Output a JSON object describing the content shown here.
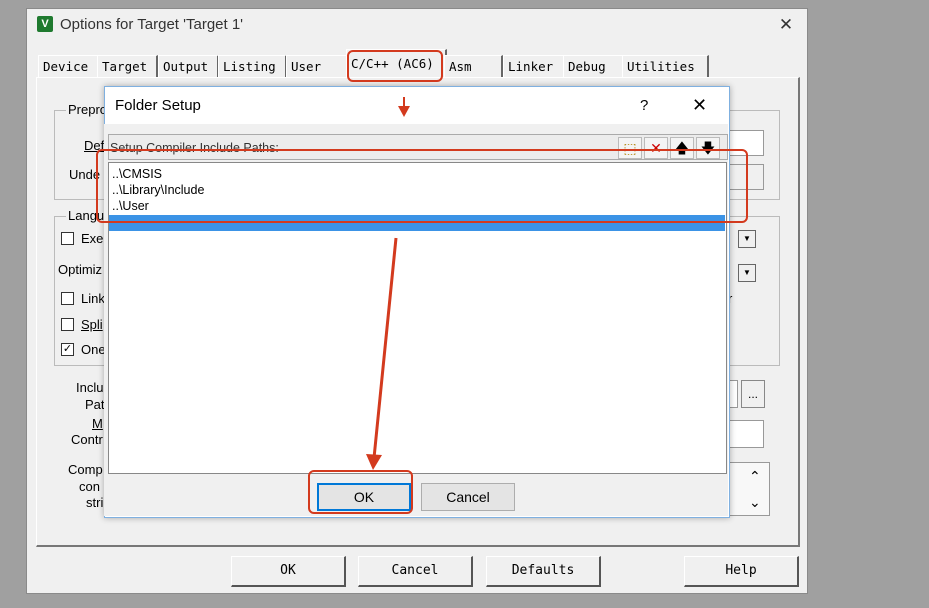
{
  "window": {
    "title": "Options for Target 'Target 1'",
    "app_icon_glyph": "V",
    "close_glyph": "✕"
  },
  "tabs": [
    {
      "label": "Device"
    },
    {
      "label": "Target"
    },
    {
      "label": "Output"
    },
    {
      "label": "Listing"
    },
    {
      "label": "User"
    },
    {
      "label": "C/C++ (AC6)"
    },
    {
      "label": "Asm"
    },
    {
      "label": "Linker"
    },
    {
      "label": "Debug"
    },
    {
      "label": "Utilities"
    }
  ],
  "background_labels": {
    "prepro": "Prepro",
    "define": "Def",
    "undefine": "Unde",
    "language": "Langu",
    "exe": "Exe",
    "optimiz": "Optimiz",
    "link": "Link",
    "split": "Spli",
    "one": "One",
    "include": "Inclu",
    "paths": "Pat",
    "misc": "M",
    "controls": "Contr",
    "compiler": "Comp",
    "control": "con",
    "string": "stri",
    "r": "r",
    "browse": "..."
  },
  "dialog": {
    "title": "Folder Setup",
    "help": "?",
    "close": "✕",
    "list_header": "Setup Compiler Include Paths:",
    "toolbar_icons": [
      "new-folder-icon",
      "delete-icon",
      "move-up-icon",
      "move-down-icon"
    ],
    "toolbar_glyphs": [
      "⬚",
      "✕",
      "🡅",
      "🡇"
    ],
    "paths": [
      "..\\CMSIS",
      "..\\Library\\Include",
      "..\\User"
    ],
    "ok_label": "OK",
    "cancel_label": "Cancel"
  },
  "bottom_buttons": {
    "ok": "OK",
    "cancel": "Cancel",
    "defaults": "Defaults",
    "help": "Help"
  },
  "colors": {
    "annotation_red": "#d33a1e",
    "selection_blue": "#3b93e6"
  }
}
